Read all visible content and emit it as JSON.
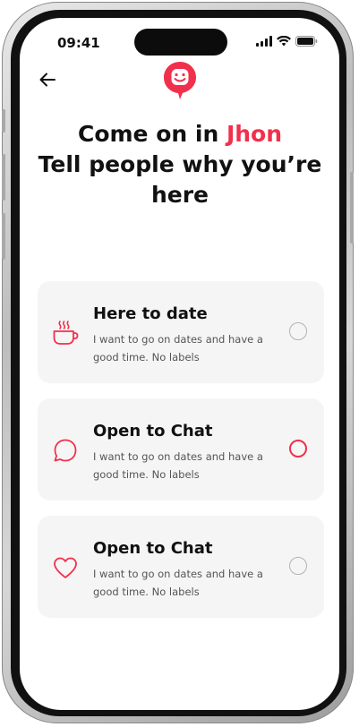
{
  "status_bar": {
    "time": "09:41",
    "icons": [
      "signal-icon",
      "wifi-icon",
      "battery-icon"
    ]
  },
  "header": {
    "back_icon": "arrow-left-icon",
    "logo_icon": "chat-face-logo-icon"
  },
  "heading": {
    "line1_prefix": "Come on in ",
    "name": "Jhon",
    "line2": "Tell people why you’re here"
  },
  "options": [
    {
      "icon": "coffee-cup-icon",
      "title": "Here to date",
      "description": "I want to go on dates and have a good time. No labels",
      "selected": false
    },
    {
      "icon": "chat-bubble-icon",
      "title": "Open to Chat",
      "description": "I want to go on dates and have a good time. No labels",
      "selected": false
    },
    {
      "icon": "heart-icon",
      "title": "Open to Chat",
      "description": "I want to go on dates and have a good time. No labels",
      "selected": false
    }
  ],
  "colors": {
    "accent": "#f1304b",
    "card_bg": "#f5f5f5",
    "text": "#111111",
    "muted_text": "#555555",
    "radio_border": "#b3b3b3"
  }
}
